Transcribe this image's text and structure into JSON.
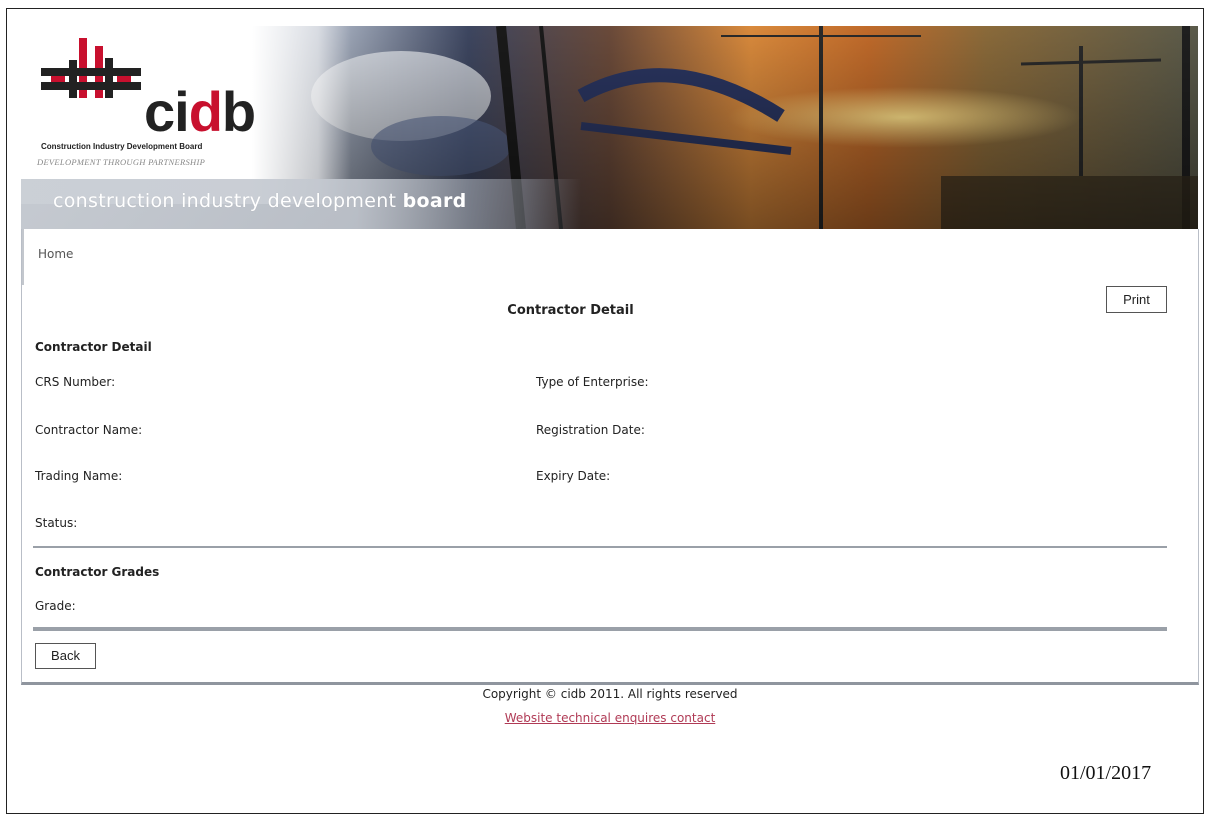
{
  "header": {
    "logo_word_prefix": "ci",
    "logo_word_accent": "d",
    "logo_word_suffix": "b",
    "logo_subtitle": "Construction Industry Development Board",
    "tagline": "DEVELOPMENT THROUGH PARTNERSHIP",
    "banner_text_light": "construction industry development ",
    "banner_text_bold": "board"
  },
  "breadcrumb": {
    "home": "Home"
  },
  "page": {
    "title": "Contractor Detail",
    "print_label": "Print",
    "back_label": "Back"
  },
  "contractor_detail": {
    "heading": "Contractor Detail",
    "fields_left": [
      "CRS Number:",
      "Contractor Name:",
      "Trading Name:",
      "Status:"
    ],
    "fields_right": [
      "Type of Enterprise:",
      "Registration Date:",
      "Expiry Date:"
    ]
  },
  "contractor_grades": {
    "heading": "Contractor Grades",
    "grade_label": "Grade:"
  },
  "footer": {
    "copyright": "Copyright © cidb 2011. All rights reserved",
    "contact_link": "Website technical enquires contact",
    "date": "01/01/2017"
  },
  "colors": {
    "brand_red": "#c8102e",
    "link": "#b03a55"
  }
}
